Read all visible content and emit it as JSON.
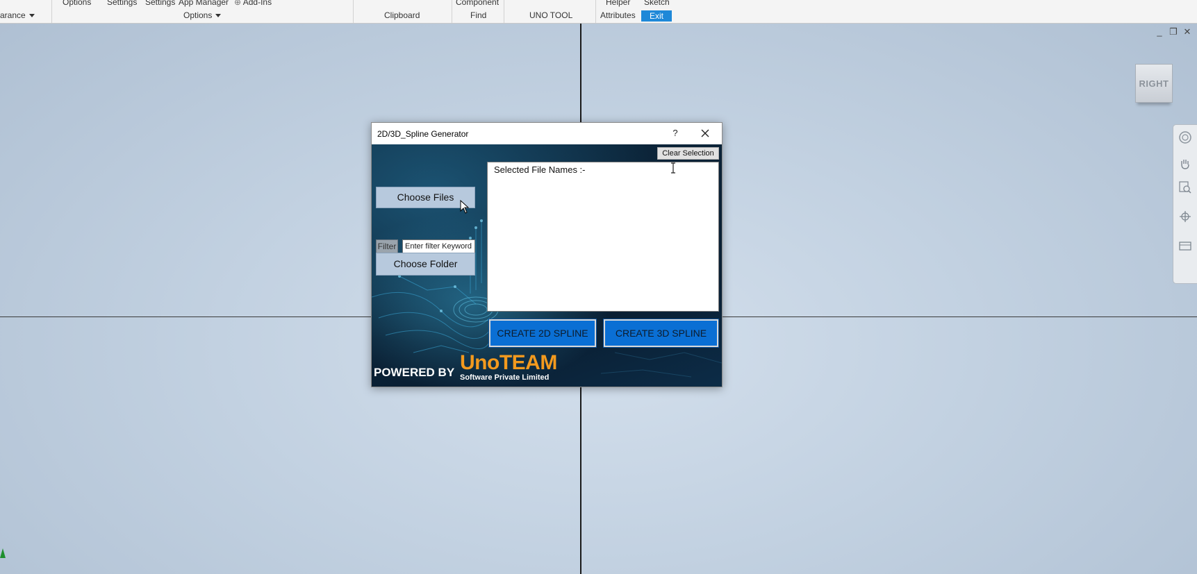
{
  "ribbon": {
    "top_items": [
      "Options",
      "Settings",
      "Settings",
      "App Manager",
      "Add-Ins",
      "Component",
      "Helper",
      "Sketch"
    ],
    "groups": {
      "appearance": "arance",
      "options": "Options",
      "clipboard": "Clipboard",
      "find": "Find",
      "uno_tool": "UNO TOOL",
      "attributes": "Attributes",
      "exit": "Exit"
    }
  },
  "viewcube": {
    "label": "RIGHT"
  },
  "dialog": {
    "title": "2D/3D_Spline Generator",
    "help": "?",
    "clear_selection": "Clear Selection",
    "choose_files": "Choose Files",
    "filter_label": "Filter",
    "filter_value": "Enter filter Keyword",
    "choose_folder": "Choose Folder",
    "file_list_label": "Selected File Names :-",
    "create_2d": "CREATE 2D SPLINE",
    "create_3d": "CREATE 3D SPLINE",
    "powered_by": "POWERED BY",
    "logo_main": "UnoTEAM",
    "logo_sub": "Software Private Limited"
  },
  "colors": {
    "exit_bg": "#1e88d8",
    "create_button": "#0a6fd4",
    "logo_orange": "#f39a1e",
    "dialog_bg_dark": "#0b2236"
  }
}
